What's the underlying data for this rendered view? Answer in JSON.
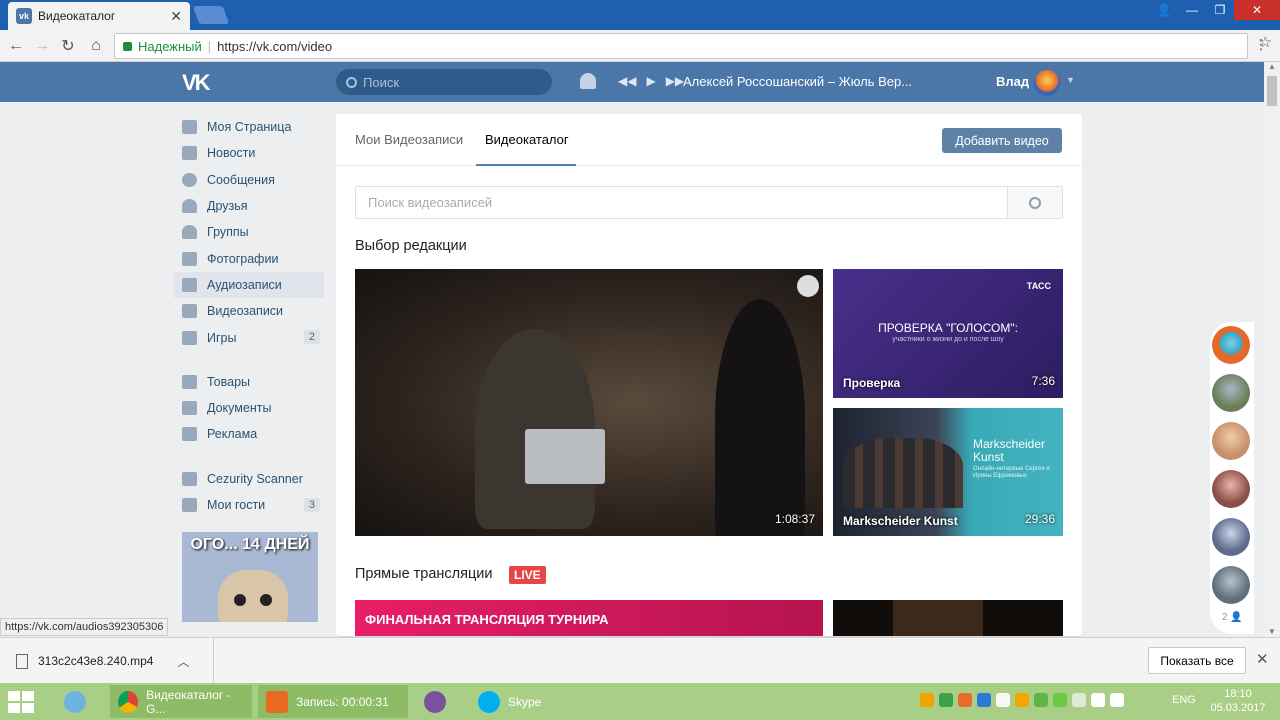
{
  "browser": {
    "tab_title": "Видеокаталог",
    "secure_label": "Надежный",
    "url": "https://vk.com/video",
    "status_url": "https://vk.com/audios392305306"
  },
  "vk_header": {
    "logo": "VK",
    "search_placeholder": "Поиск",
    "track": "Алексей Россошанский – Жюль Вер...",
    "user_name": "Влад"
  },
  "left_menu": {
    "items": [
      {
        "label": "Моя Страница",
        "icon": "home-icon"
      },
      {
        "label": "Новости",
        "icon": "news-icon"
      },
      {
        "label": "Сообщения",
        "icon": "messages-icon"
      },
      {
        "label": "Друзья",
        "icon": "friends-icon"
      },
      {
        "label": "Группы",
        "icon": "groups-icon"
      },
      {
        "label": "Фотографии",
        "icon": "camera-icon"
      },
      {
        "label": "Аудиозаписи",
        "icon": "music-icon"
      },
      {
        "label": "Видеозаписи",
        "icon": "video-icon"
      },
      {
        "label": "Игры",
        "icon": "gamepad-icon",
        "count": "2"
      }
    ],
    "items2": [
      {
        "label": "Товары",
        "icon": "bag-icon"
      },
      {
        "label": "Документы",
        "icon": "document-icon"
      },
      {
        "label": "Реклама",
        "icon": "megaphone-icon"
      }
    ],
    "items3": [
      {
        "label": "Cezurity Scanner",
        "icon": "app-icon"
      },
      {
        "label": "Мои гости",
        "icon": "app-icon",
        "count": "3"
      }
    ],
    "promo_text": "ОГО... 14 ДНЕЙ"
  },
  "video_page": {
    "tab_my": "Мои Видеозаписи",
    "tab_catalog": "Видеокаталог",
    "add_button": "Добавить видео",
    "search_placeholder": "Поиск видеозаписей",
    "editors_choice": "Выбор редакции",
    "live_section": "Прямые трансляции",
    "live_badge": "LIVE",
    "videos": [
      {
        "title": "",
        "duration": "1:08:37"
      },
      {
        "title": "Проверка",
        "duration": "7:36",
        "headline": "ПРОВЕРКА \"ГОЛОСОМ\":",
        "subline": "участники о жизни до и после шоу",
        "brand": "ТАСС"
      },
      {
        "title": "Markscheider Kunst",
        "duration": "29:36",
        "art_title": "Markscheider Kunst",
        "art_sub": "Онлайн-интервью Сергея и Ирины Ефремовых"
      }
    ],
    "live_banner": "ФИНАЛЬНАЯ ТРАНСЛЯЦИЯ ТУРНИРА"
  },
  "friends_panel": {
    "count": "2"
  },
  "downloads": {
    "file": "313c2c43e8.240.mp4",
    "show_all": "Показать все"
  },
  "taskbar": {
    "items": [
      {
        "label": "Видеокаталог - G..."
      },
      {
        "label": "Запись:  00:00:31"
      },
      {
        "label": ""
      },
      {
        "label": "Skype"
      }
    ],
    "lang": "ENG",
    "time": "18:10",
    "date": "05.03.2017"
  }
}
